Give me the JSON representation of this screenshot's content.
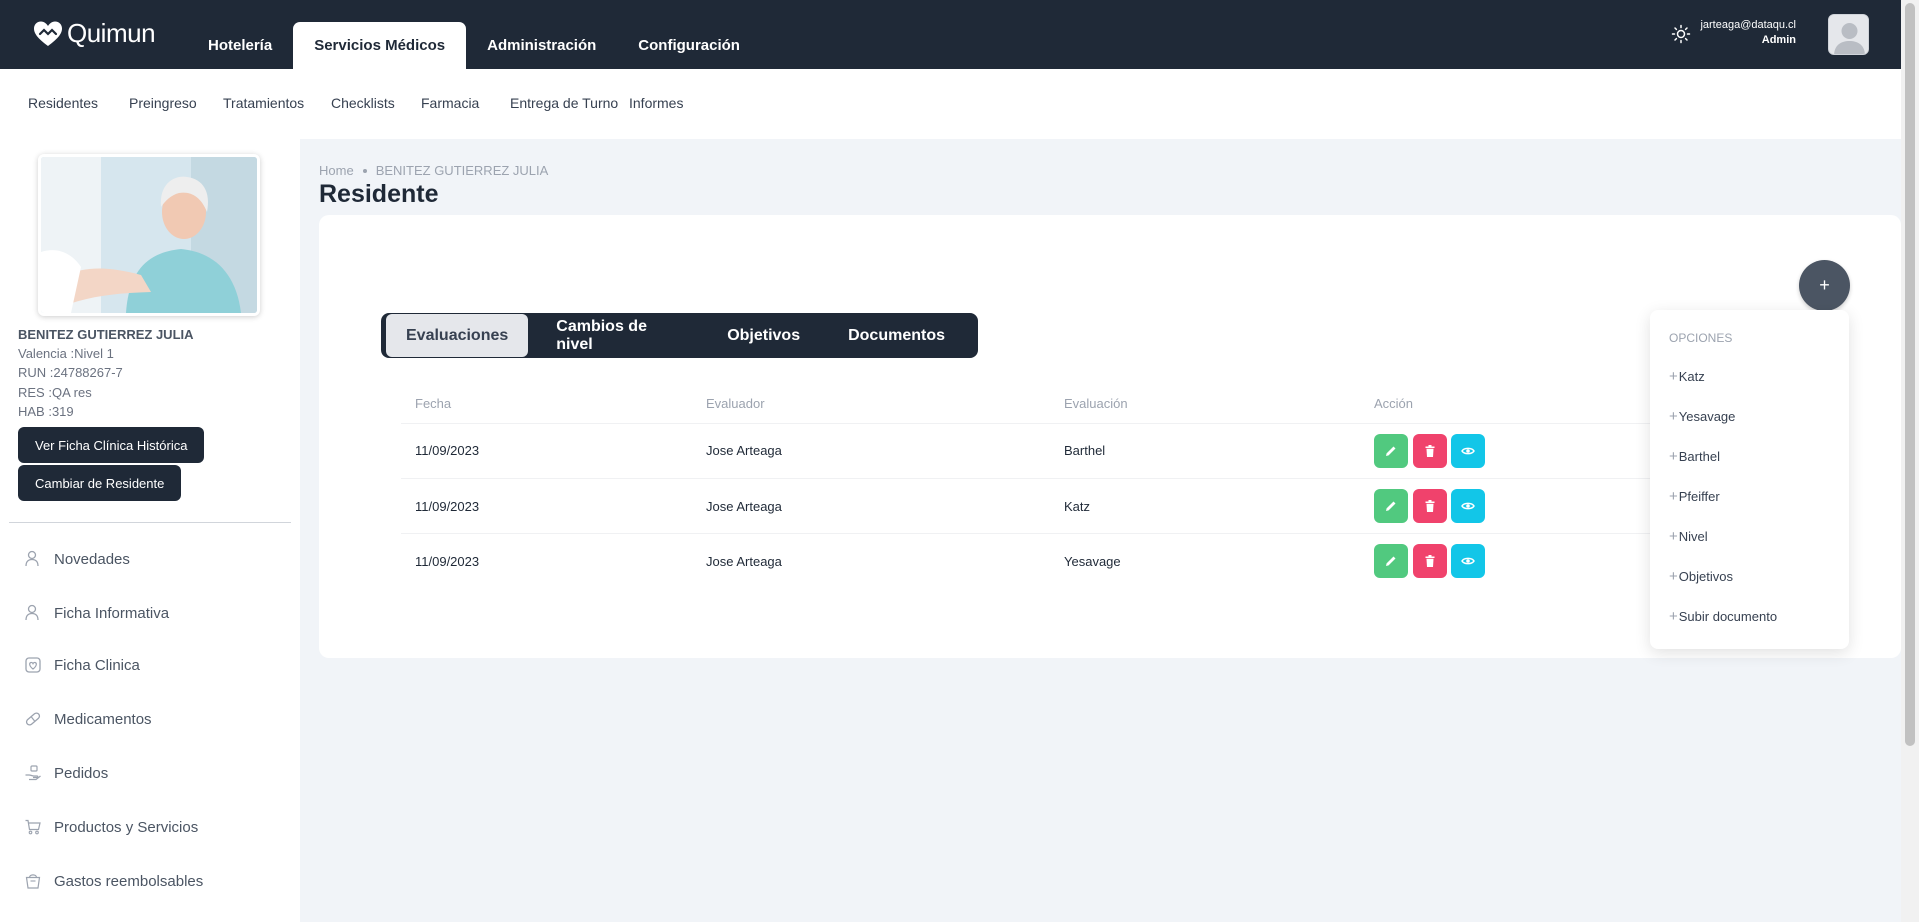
{
  "app": {
    "name": "Quimun"
  },
  "main_nav": [
    {
      "label": "Hotelería",
      "active": false
    },
    {
      "label": "Servicios Médicos",
      "active": true
    },
    {
      "label": "Administración",
      "active": false
    },
    {
      "label": "Configuración",
      "active": false
    }
  ],
  "user": {
    "email": "jarteaga@dataqu.cl",
    "role": "Admin"
  },
  "sub_nav": [
    "Residentes",
    "Preingreso",
    "Tratamientos",
    "Checklists",
    "Farmacia",
    "Entrega de Turno",
    "Informes"
  ],
  "resident": {
    "name": "BENITEZ GUTIERREZ JULIA",
    "info": [
      "Valencia :Nivel 1",
      "RUN :24788267-7",
      "RES :QA res",
      "HAB :319"
    ],
    "btn_history": "Ver Ficha Clínica Histórica",
    "btn_change": "Cambiar de Residente"
  },
  "sidebar_menu": [
    "Novedades",
    "Ficha Informativa",
    "Ficha Clinica",
    "Medicamentos",
    "Pedidos",
    "Productos y Servicios",
    "Gastos reembolsables"
  ],
  "breadcrumb": {
    "home": "Home",
    "current": "BENITEZ GUTIERREZ JULIA"
  },
  "page_title": "Residente",
  "fab_label": "+",
  "tabs": [
    {
      "label": "Evaluaciones",
      "active": true
    },
    {
      "label": "Cambios de nivel",
      "active": false
    },
    {
      "label": "Objetivos",
      "active": false
    },
    {
      "label": "Documentos",
      "active": false
    }
  ],
  "table": {
    "headers": [
      "Fecha",
      "Evaluador",
      "Evaluación",
      "Acción"
    ],
    "rows": [
      {
        "fecha": "11/09/2023",
        "evaluador": "Jose Arteaga",
        "evaluacion": "Barthel"
      },
      {
        "fecha": "11/09/2023",
        "evaluador": "Jose Arteaga",
        "evaluacion": "Katz"
      },
      {
        "fecha": "11/09/2023",
        "evaluador": "Jose Arteaga",
        "evaluacion": "Yesavage"
      }
    ]
  },
  "dropdown": {
    "header": "OPCIONES",
    "options": [
      "Katz",
      "Yesavage",
      "Barthel",
      "Pfeiffer",
      "Nivel",
      "Objetivos",
      "Subir documento"
    ]
  },
  "colors": {
    "dark": "#1f2937",
    "edit": "#51c97f",
    "delete": "#f0426c",
    "view": "#12c6e8"
  }
}
